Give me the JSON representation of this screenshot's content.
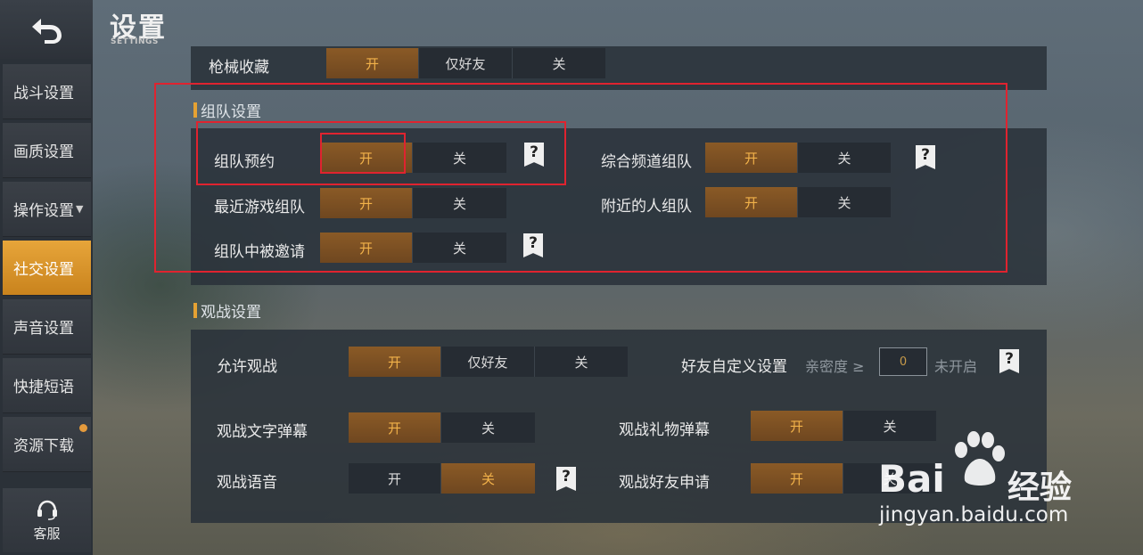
{
  "header": {
    "title": "设置",
    "subtitle": "SETTINGS"
  },
  "sidebar": {
    "items": [
      {
        "label": "战斗设置"
      },
      {
        "label": "画质设置"
      },
      {
        "label": "操作设置"
      },
      {
        "label": "社交设置"
      },
      {
        "label": "声音设置"
      },
      {
        "label": "快捷短语"
      },
      {
        "label": "资源下载"
      }
    ],
    "active_index": 3,
    "service_label": "客服"
  },
  "gun_row": {
    "label": "枪械收藏",
    "options": [
      "开",
      "仅好友",
      "关"
    ],
    "selected": "开"
  },
  "team": {
    "section_title": "组队设置",
    "team_reserve": {
      "label": "组队预约",
      "options": [
        "开",
        "关"
      ],
      "selected": "开"
    },
    "channel_team": {
      "label": "综合频道组队",
      "options": [
        "开",
        "关"
      ],
      "selected": "开"
    },
    "recent_team": {
      "label": "最近游戏组队",
      "options": [
        "开",
        "关"
      ],
      "selected": "开"
    },
    "nearby_team": {
      "label": "附近的人组队",
      "options": [
        "开",
        "关"
      ],
      "selected": "开"
    },
    "invited_team": {
      "label": "组队中被邀请",
      "options": [
        "开",
        "关"
      ],
      "selected": "开"
    }
  },
  "spectate": {
    "section_title": "观战设置",
    "allow": {
      "label": "允许观战",
      "options": [
        "开",
        "仅好友",
        "关"
      ],
      "selected": "开"
    },
    "friend_custom": {
      "label": "好友自定义设置",
      "intimacy_label": "亲密度 ≥",
      "intimacy_value": "0",
      "status": "未开启"
    },
    "text_barrage": {
      "label": "观战文字弹幕",
      "options": [
        "开",
        "关"
      ],
      "selected": "开"
    },
    "gift_barrage": {
      "label": "观战礼物弹幕",
      "options": [
        "开",
        "关"
      ],
      "selected": "开"
    },
    "voice": {
      "label": "观战语音",
      "options": [
        "开",
        "关"
      ],
      "selected": "关"
    },
    "friend_request": {
      "label": "观战好友申请",
      "options": [
        "开",
        "关"
      ],
      "selected": "开"
    }
  },
  "help_glyph": "?",
  "watermark": {
    "brand": "Bai",
    "brand2": "经验",
    "url": "jingyan.baidu.com"
  },
  "colors": {
    "accent": "#e6a233",
    "highlight_box": "#e0232f",
    "active_tab": "#e7a53a"
  }
}
